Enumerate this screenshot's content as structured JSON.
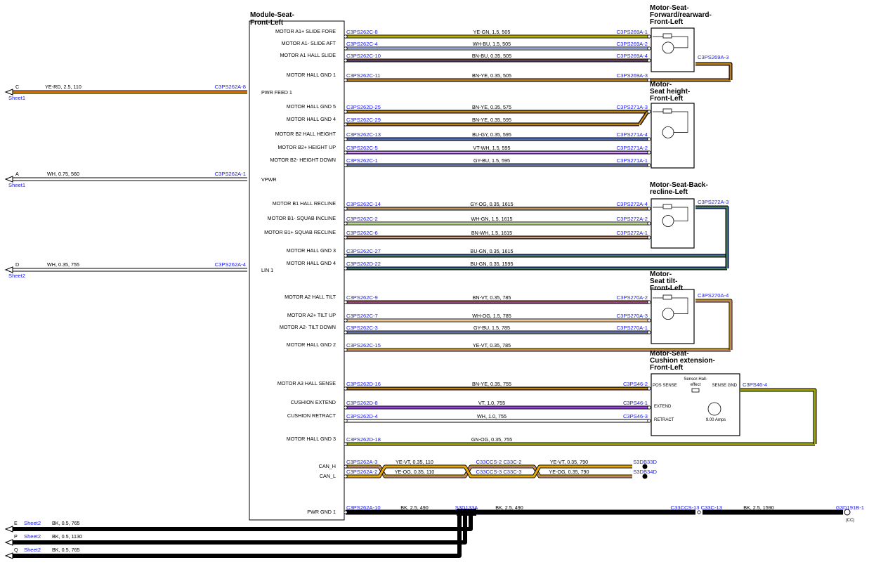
{
  "colors": {
    "YE": "#e8c000",
    "GN": "#72b000",
    "WH": "#ffffff",
    "BU": "#1a3fb0",
    "BN": "#8a4a22",
    "RD": "#e01010",
    "GY": "#9a9a9a",
    "VT": "#9a44e0",
    "OG": "#f08a10",
    "BK": "#000000",
    "pin": "#1a1ae6"
  },
  "module": {
    "title_line1": "Module-Seat-",
    "title_line2": "Front-Left"
  },
  "left_wires": [
    {
      "letter": "C",
      "sheet": "Sheet1",
      "spec": "YE-RD,  2.5,  110",
      "pin": "C3PS262A-8",
      "label": "PWR FEED 1",
      "c1": "YE",
      "c2": "RD"
    },
    {
      "letter": "A",
      "sheet": "Sheet1",
      "spec": "WH,  0.75,  560",
      "pin": "C3PS262A-1",
      "label": "VPWR",
      "c1": "WH"
    },
    {
      "letter": "D",
      "sheet": "Sheet2",
      "spec": "WH,  0.35,  755",
      "pin": "C3PS262A-4",
      "label": "LIN 1",
      "c1": "WH"
    }
  ],
  "motors": [
    {
      "title": [
        "Motor-Seat-",
        "Forward/rearward-",
        "Front-Left"
      ]
    },
    {
      "title": [
        "Motor-",
        "Seat height-",
        "Front-Left"
      ]
    },
    {
      "title": [
        "Motor-Seat-Back-",
        "recline-Left"
      ]
    },
    {
      "title": [
        "Motor-",
        "Seat tilt-",
        "Front-Left"
      ]
    },
    {
      "title": [
        "Motor-Seat-",
        "Cushion extension-",
        "Front-Left"
      ],
      "pins": [
        "POS SENSE",
        "SENSE GND",
        "EXTEND",
        "RETRACT"
      ],
      "sensor": "Sensor-Hall-",
      "sensor2": "effect",
      "amps": "9.00 Amps"
    }
  ],
  "wires": [
    {
      "label": "MOTOR A1+ SLIDE FORE",
      "lpin": "C3PS262C-8",
      "spec": "YE-GN,  1.5,  505",
      "rpin": "C3PS269A-1",
      "c1": "YE",
      "c2": "GN"
    },
    {
      "label": "MOTOR A1- SLIDE AFT",
      "lpin": "C3PS262C-4",
      "spec": "WH-BU,  1.5,  505",
      "rpin": "C3PS269A-2",
      "c1": "WH",
      "c2": "BU"
    },
    {
      "label": "MOTOR A1 HALL SLIDE",
      "lpin": "C3PS262C-10",
      "spec": "BN-BU,  0.35,  505",
      "rpin": "C3PS269A-4",
      "c1": "BN",
      "c2": "BU"
    },
    {
      "label": "MOTOR HALL GND 1",
      "lpin": "C3PS262C-11",
      "spec": "BN-YE,  0.35,  505",
      "rpin": "C3PS269A-3",
      "c1": "BN",
      "c2": "YE"
    },
    {
      "label": "MOTOR HALL GND 5",
      "lpin": "C3PS262D-25",
      "spec": "BN-YE,  0.35,  575",
      "rpin": "C3PS271A-3",
      "c1": "BN",
      "c2": "YE"
    },
    {
      "label": "MOTOR HALL GND 4",
      "lpin": "C3PS262C-29",
      "spec": "BN-YE,  0.35,  595",
      "rpin": "",
      "c1": "BN",
      "c2": "YE"
    },
    {
      "label": "MOTOR B2 HALL HEIGHT",
      "lpin": "C3PS262C-13",
      "spec": "BU-GY,  0.35,  595",
      "rpin": "C3PS271A-4",
      "c1": "BU",
      "c2": "GY"
    },
    {
      "label": "MOTOR B2+ HEIGHT UP",
      "lpin": "C3PS262C-5",
      "spec": "VT-WH,  1.5,  595",
      "rpin": "C3PS271A-2",
      "c1": "VT",
      "c2": "WH"
    },
    {
      "label": "MOTOR B2- HEIGHT DOWN",
      "lpin": "C3PS262C-1",
      "spec": "GY-BU,  1.5,  595",
      "rpin": "C3PS271A-1",
      "c1": "GY",
      "c2": "BU"
    },
    {
      "label": "MOTOR B1 HALL RECLINE",
      "lpin": "C3PS262C-14",
      "spec": "GY-OG,  0.35,  1615",
      "rpin": "C3PS272A-4",
      "c1": "GY",
      "c2": "OG"
    },
    {
      "label": "MOTOR B1- SQUAB INCLINE",
      "lpin": "C3PS262C-2",
      "spec": "WH-GN,  1.5,  1615",
      "rpin": "C3PS272A-2",
      "c1": "WH",
      "c2": "GN"
    },
    {
      "label": "MOTOR B1+ SQUAB RECLINE",
      "lpin": "C3PS262C-6",
      "spec": "BN-WH,  1.5,  1615",
      "rpin": "C3PS272A-1",
      "c1": "BN",
      "c2": "WH"
    },
    {
      "label": "MOTOR HALL GND 3",
      "lpin": "C3PS262C-27",
      "spec": "BU-GN,  0.35,  1615",
      "rpin": "",
      "c1": "BU",
      "c2": "GN"
    },
    {
      "label": "MOTOR HALL GND 4",
      "lpin": "C3PS262D-22",
      "spec": "BU-GN,  0.35,  1595",
      "rpin": "",
      "c1": "BU",
      "c2": "GN"
    },
    {
      "label": "MOTOR A2 HALL TILT",
      "lpin": "C3PS262C-9",
      "spec": "BN-VT,  0.35,  785",
      "rpin": "C3PS270A-2",
      "c1": "BN",
      "c2": "VT"
    },
    {
      "label": "MOTOR A2+ TILT UP",
      "lpin": "C3PS262C-7",
      "spec": "WH-OG,  1.5,  785",
      "rpin": "C3PS270A-3",
      "c1": "WH",
      "c2": "OG"
    },
    {
      "label": "MOTOR A2- TILT DOWN",
      "lpin": "C3PS262C-3",
      "spec": "GY-BU,  1.5,  785",
      "rpin": "C3PS270A-1",
      "c1": "GY",
      "c2": "BU"
    },
    {
      "label": "MOTOR HALL GND 2",
      "lpin": "C3PS262C-15",
      "spec": "YE-VT,  0.35,  785",
      "rpin": "",
      "c1": "YE",
      "c2": "VT"
    },
    {
      "label": "MOTOR A3 HALL SENSE",
      "lpin": "C3PS262D-16",
      "spec": "BN-YE,  0.35,  755",
      "rpin": "C3PS46-2",
      "c1": "BN",
      "c2": "YE"
    },
    {
      "label": "CUSHION EXTEND",
      "lpin": "C3PS262D-8",
      "spec": "VT,  1.0,  755",
      "rpin": "C3PS46-1",
      "c1": "VT"
    },
    {
      "label": "CUSHION RETRACT",
      "lpin": "C3PS262D-4",
      "spec": "WH,  1.0,  755",
      "rpin": "C3PS46-3",
      "c1": "WH"
    },
    {
      "label": "MOTOR HALL GND 3",
      "lpin": "C3PS262D-18",
      "spec": "GN-OG,  0.35,  755",
      "rpin": "",
      "c1": "GN",
      "c2": "OG"
    }
  ],
  "ext_pins": [
    "C3PS269A-3",
    "C3PS272A-3",
    "C3PS270A-4",
    "C3PS46-4"
  ],
  "can": [
    {
      "label": "CAN_H",
      "lpin": "C3PS262A-3",
      "spec1": "YE-VT,  0.35,  110",
      "mid": "C33CCS-2  C33C-2",
      "spec2": "YE-VT,  0.35,  790",
      "end": "S3DB33D",
      "c1": "YE",
      "c2": "VT"
    },
    {
      "label": "CAN_L",
      "lpin": "C3PS262A-2",
      "spec1": "YE-OG,  0.35,  110",
      "mid": "C33CCS-3  C33C-3",
      "spec2": "YE-OG,  0.35,  790",
      "end": "S3DB34D",
      "c1": "YE",
      "c2": "OG"
    }
  ],
  "ground": {
    "label": "PWR GND 1",
    "lpin": "C3PS262A-10",
    "spec1": "BK,  2.5,  490",
    "splice": "S3D133A",
    "spec2": "BK,  2.5,  490",
    "mid": "C33CCS-13  C33C-13",
    "spec3": "BK,  2.5,  1590",
    "end": "G3D191B-1",
    "cc": "(CC)"
  },
  "bottom_wires": [
    {
      "letter": "E",
      "sheet": "Sheet2",
      "spec": "BK,  0.5,  765"
    },
    {
      "letter": "P",
      "sheet": "Sheet2",
      "spec": "BK,  0.5,  1130"
    },
    {
      "letter": "Q",
      "sheet": "Sheet2",
      "spec": "BK,  0.5,  765"
    }
  ]
}
